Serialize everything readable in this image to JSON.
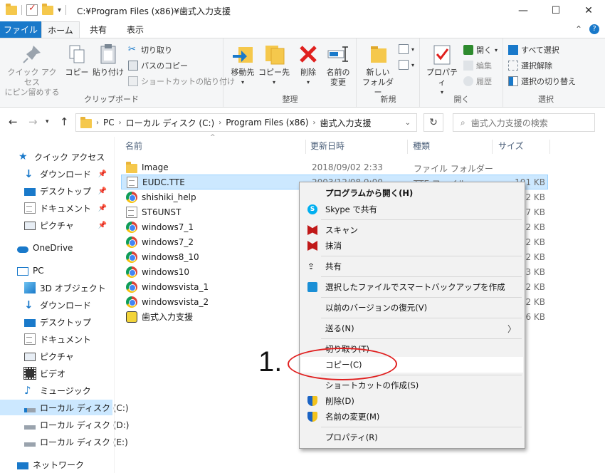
{
  "window": {
    "title": "C:¥Program Files (x86)¥歯式入力支援"
  },
  "ribbon_tabs": [
    "ファイル",
    "ホーム",
    "共有",
    "表示"
  ],
  "ribbon": {
    "clipboard": {
      "group_label": "クリップボード",
      "pin_label_1": "クイック アクセス",
      "pin_label_2": "にピン留めする",
      "copy": "コピー",
      "paste": "貼り付け",
      "cut": "切り取り",
      "copy_path": "パスのコピー",
      "paste_shortcut": "ショートカットの貼り付け"
    },
    "organize": {
      "group_label": "整理",
      "move_to": "移動先",
      "copy_to": "コピー先",
      "delete": "削除",
      "rename_1": "名前の",
      "rename_2": "変更"
    },
    "new": {
      "group_label": "新規",
      "new_folder_1": "新しい",
      "new_folder_2": "フォルダー"
    },
    "open": {
      "group_label": "開く",
      "properties": "プロパティ",
      "open": "開く",
      "edit": "編集",
      "history": "履歴"
    },
    "select": {
      "group_label": "選択",
      "select_all": "すべて選択",
      "select_none": "選択解除",
      "invert": "選択の切り替え"
    }
  },
  "address": {
    "crumbs": [
      "PC",
      "ローカル ディスク (C:)",
      "Program Files (x86)",
      "歯式入力支援"
    ],
    "search_placeholder": "歯式入力支援の検索"
  },
  "nav": {
    "quick_access": "クイック アクセス",
    "qa_items": [
      "ダウンロード",
      "デスクトップ",
      "ドキュメント",
      "ピクチャ"
    ],
    "onedrive": "OneDrive",
    "pc": "PC",
    "pc_items": [
      "3D オブジェクト",
      "ダウンロード",
      "デスクトップ",
      "ドキュメント",
      "ピクチャ",
      "ビデオ",
      "ミュージック",
      "ローカル ディスク (C:)",
      "ローカル ディスク (D:)",
      "ローカル ディスク (E:)"
    ],
    "network": "ネットワーク"
  },
  "columns": {
    "name": "名前",
    "date": "更新日時",
    "type": "種類",
    "size": "サイズ"
  },
  "files": [
    {
      "name": "Image",
      "date": "2018/09/02 2:33",
      "type": "ファイル フォルダー",
      "size": ""
    },
    {
      "name": "EUDC.TTE",
      "date": "2003/12/08 9:00",
      "type": "TTE ファイル",
      "size": "101 KB"
    },
    {
      "name": "shishiki_help",
      "size": "12 KB"
    },
    {
      "name": "ST6UNST",
      "size": "7 KB"
    },
    {
      "name": "windows7_1",
      "size": "2 KB"
    },
    {
      "name": "windows7_2",
      "size": "2 KB"
    },
    {
      "name": "windows8_10",
      "size": "2 KB"
    },
    {
      "name": "windows10",
      "size": "3 KB"
    },
    {
      "name": "windowsvista_1",
      "size": "2 KB"
    },
    {
      "name": "windowsvista_2",
      "size": "2 KB"
    },
    {
      "name": "歯式入力支援",
      "size": "96 KB"
    }
  ],
  "context_menu": {
    "open_with": "プログラムから開く(H)",
    "skype_share": "Skype で共有",
    "scan": "スキャン",
    "shred": "抹消",
    "share": "共有",
    "smart_backup": "選択したファイルでスマートバックアップを作成",
    "restore_prev": "以前のバージョンの復元(V)",
    "send_to": "送る(N)",
    "cut": "切り取り(T)",
    "copy": "コピー(C)",
    "create_shortcut": "ショートカットの作成(S)",
    "delete": "削除(D)",
    "rename": "名前の変更(M)",
    "properties": "プロパティ(R)"
  },
  "annotation": {
    "step": "1."
  }
}
